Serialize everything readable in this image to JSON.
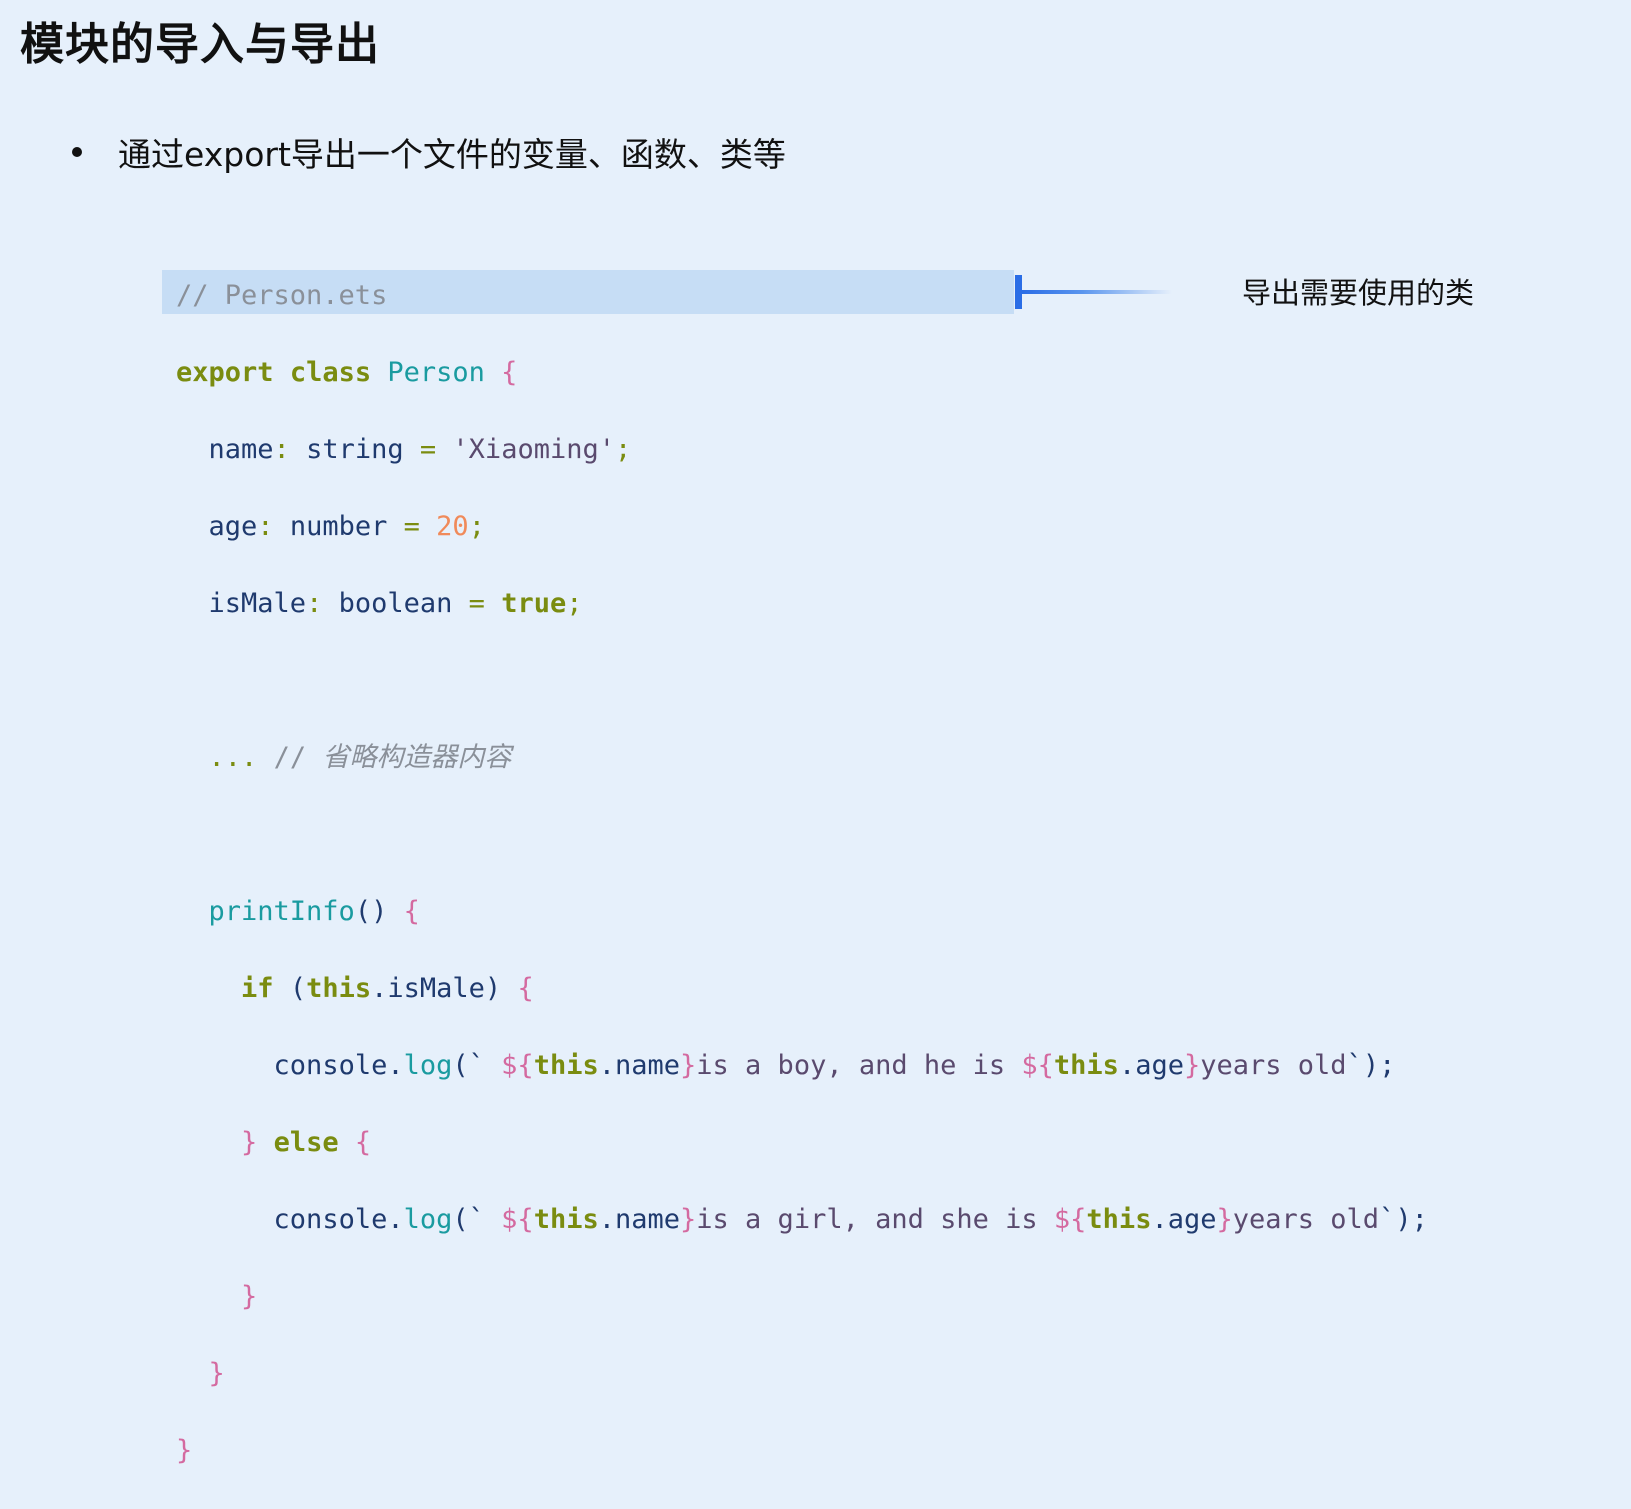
{
  "slide": {
    "title": "模块的导入与导出",
    "bullet": "通过export导出一个文件的变量、函数、类等"
  },
  "callout": {
    "text": "导出需要使用的类"
  },
  "colors": {
    "background": "#e6f0fb",
    "highlight": "#c6ddf5",
    "accent": "#2a6de6",
    "keyword": "#7a8c10",
    "type": "#1a9ba0",
    "brace": "#d46aa0",
    "property": "#1f3a6e",
    "number": "#f08a5a",
    "comment": "#8a9099"
  },
  "code": {
    "comment_file": "// Person.ets",
    "kw_export": "export",
    "kw_class": "class",
    "class_name": "Person",
    "prop_name": "name",
    "type_string": "string",
    "str_xiaoming": "'Xiaoming'",
    "prop_age": "age",
    "type_number": "number",
    "num_20": "20",
    "prop_ismale": "isMale",
    "type_boolean": "boolean",
    "kw_true": "true",
    "ellipsis": "...",
    "comment_slashes": "//",
    "comment_ctor": "省略构造器内容",
    "fn_printinfo": "printInfo",
    "kw_if": "if",
    "kw_this": "this",
    "kw_else": "else",
    "console": "console",
    "fn_log": "log",
    "tmpl_boy_1": "is a boy, and he is ",
    "tmpl_girl_1": "is a girl, and she is ",
    "tmpl_end": "years old"
  }
}
